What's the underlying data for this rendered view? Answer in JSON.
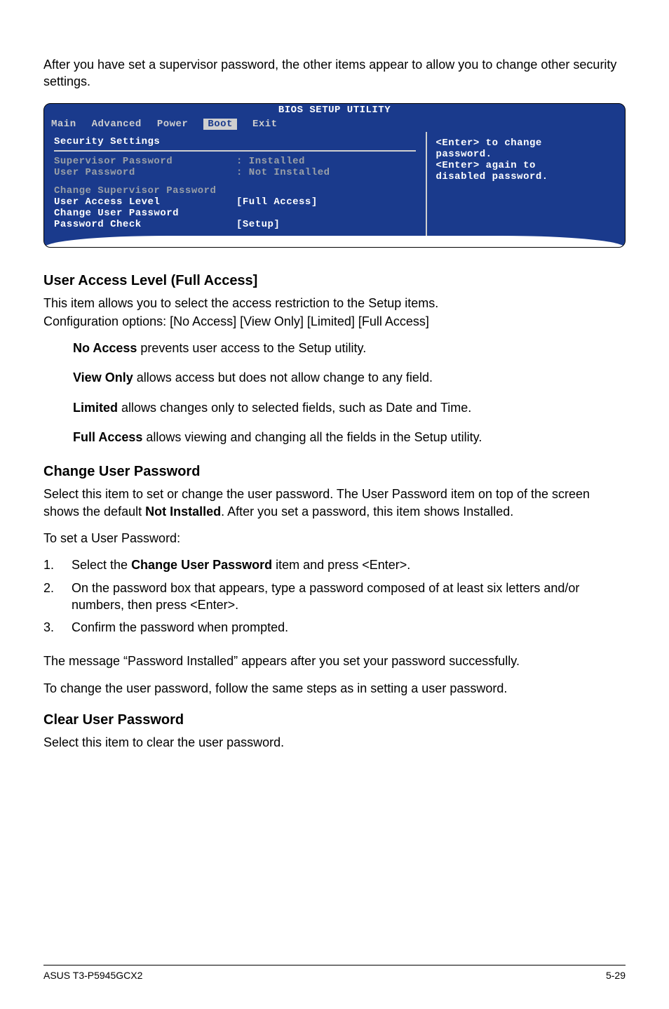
{
  "intro_para": "After you have set a supervisor password, the other items appear to allow you to change other security settings.",
  "bios": {
    "title": "BIOS SETUP UTILITY",
    "menu": [
      "Main",
      "Advanced",
      "Power",
      "Boot",
      "Exit"
    ],
    "selected_menu_index": 3,
    "section_title": "Security Settings",
    "rows_dim": [
      {
        "label": "Supervisor Password",
        "value": ": Installed"
      },
      {
        "label": "User Password",
        "value": ": Not Installed"
      }
    ],
    "change_sup": "Change Supervisor Password",
    "rows_bright": [
      {
        "label": "User Access Level",
        "value": "[Full Access]"
      },
      {
        "label": "Change User Password",
        "value": ""
      },
      {
        "label": "Password Check",
        "value": "[Setup]"
      }
    ],
    "right_text1": "<Enter> to change",
    "right_text2": "password.",
    "right_text3": "<Enter> again to",
    "right_text4": "disabled password."
  },
  "s1": {
    "heading": "User Access Level (Full Access]",
    "p1a": "This item allows you to select the access restriction to the Setup items.",
    "p1b": "Configuration options: [No Access] [View Only] [Limited] [Full Access]",
    "b1_label": "No Access",
    "b1_text": " prevents user access to the Setup utility.",
    "b2_label": "View Only",
    "b2_text": " allows access but does not allow change to any field.",
    "b3_label": "Limited",
    "b3_text": " allows changes only to selected fields, such as Date and Time.",
    "b4_label": "Full Access",
    "b4_text": " allows viewing and changing all the fields in the Setup utility."
  },
  "s2": {
    "heading": "Change User Password",
    "p1a": "Select this item to set or change the user password. The User Password item on top of the screen shows the default ",
    "p1b_bold": "Not Installed",
    "p1c": ". After you set a password, this item shows Installed.",
    "p2": "To set a User Password:",
    "li1a": "Select the ",
    "li1b_bold": "Change User Password",
    "li1c": " item and press <Enter>.",
    "li2": "On the password box that appears, type a password composed of at least six letters and/or numbers, then press <Enter>.",
    "li3": "Confirm the password when prompted.",
    "p3": "The message “Password Installed” appears after you set your password successfully.",
    "p4": "To change the user password, follow the same steps as in setting a user password."
  },
  "s3": {
    "heading": "Clear User Password",
    "p1": "Select this item to clear the user password."
  },
  "footer": {
    "left": "ASUS T3-P5945GCX2",
    "right": "5-29"
  }
}
